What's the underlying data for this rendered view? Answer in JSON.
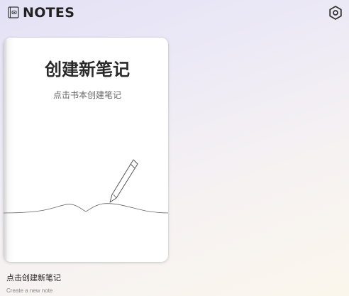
{
  "app": {
    "title": "NOTES"
  },
  "header": {
    "logo_icon": "notebook-icon",
    "settings_icon": "hexagon-gear-icon"
  },
  "notebook": {
    "cover_title": "创建新笔记",
    "cover_subtitle": "点击书本创建笔记",
    "illustration_icon": "pencil-icon"
  },
  "caption": {
    "title": "点击创建新笔记",
    "subtitle": "Create a new note"
  }
}
